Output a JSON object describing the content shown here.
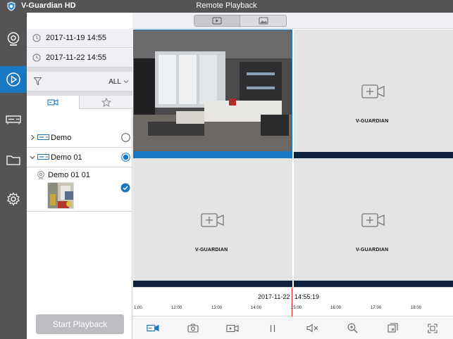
{
  "app": {
    "name": "V-Guardian HD",
    "window_title": "Remote Playback",
    "accent_color": "#1a78c2"
  },
  "segments": [
    {
      "icon": "video-play-icon",
      "selected": true
    },
    {
      "icon": "image-icon",
      "selected": false
    }
  ],
  "nav": {
    "items": [
      {
        "icon": "webcam-icon",
        "active": false
      },
      {
        "icon": "playback-icon",
        "active": true
      },
      {
        "icon": "nvr-device-icon",
        "active": false
      },
      {
        "icon": "folder-icon",
        "active": false
      },
      {
        "icon": "gear-icon",
        "active": false
      }
    ]
  },
  "panel": {
    "start_time": "2017-11-19 14:55",
    "end_time": "2017-11-22 14:55",
    "filter_value": "ALL",
    "tabs": [
      {
        "icon": "camera-tab-icon",
        "selected": true
      },
      {
        "icon": "star-tab-icon",
        "selected": false
      }
    ],
    "devices": [
      {
        "name": "Demo",
        "expanded": false,
        "selected": false
      },
      {
        "name": "Demo 01",
        "expanded": true,
        "selected": true
      }
    ],
    "channel": {
      "name": "Demo 01 01",
      "checked": true
    },
    "start_button": "Start Playback"
  },
  "grid": {
    "logo_text": "V-GUARDIAN"
  },
  "timeline": {
    "date": "2017-11-22",
    "time": "14:55:19",
    "ticks": [
      "1:00",
      "12:00",
      "13:00",
      "14:00",
      "15:00",
      "16:00",
      "17:00",
      "18:00"
    ]
  },
  "toolbar": {
    "icons": [
      "camera-record-icon",
      "snapshot-icon",
      "record-clip-icon",
      "pause-icon",
      "mute-icon",
      "zoom-in-icon",
      "split-screen-icon",
      "fullscreen-icon"
    ]
  }
}
